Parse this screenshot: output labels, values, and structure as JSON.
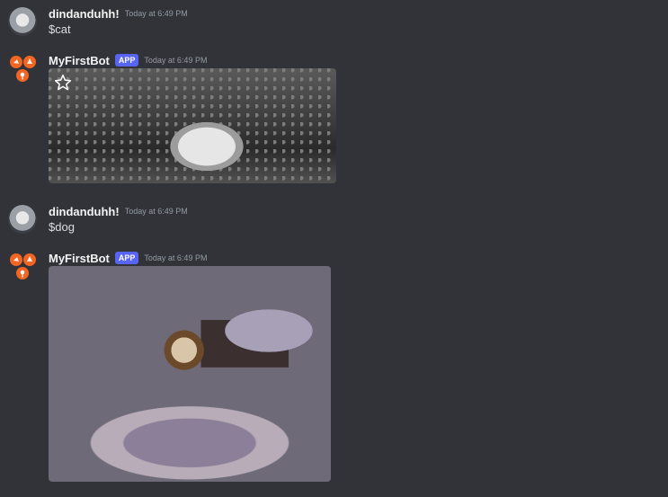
{
  "messages": [
    {
      "username": "dindanduhh!",
      "timestamp": "Today at 6:49 PM",
      "content": "$cat"
    },
    {
      "username": "MyFirstBot",
      "badge": "APP",
      "timestamp": "Today at 6:49 PM",
      "image": "cat-under-blanket"
    },
    {
      "username": "dindanduhh!",
      "timestamp": "Today at 6:49 PM",
      "content": "$dog"
    },
    {
      "username": "MyFirstBot",
      "badge": "APP",
      "timestamp": "Today at 6:49 PM",
      "image": "dog-on-bed"
    }
  ],
  "icons": {
    "favorite": "star-icon",
    "bot_avatar": "bot-avatar-icon"
  },
  "colors": {
    "background": "#313338",
    "username": "#f2f3f5",
    "timestamp": "#949ba4",
    "badge": "#5865f2",
    "bot_avatar": "#f26522"
  }
}
